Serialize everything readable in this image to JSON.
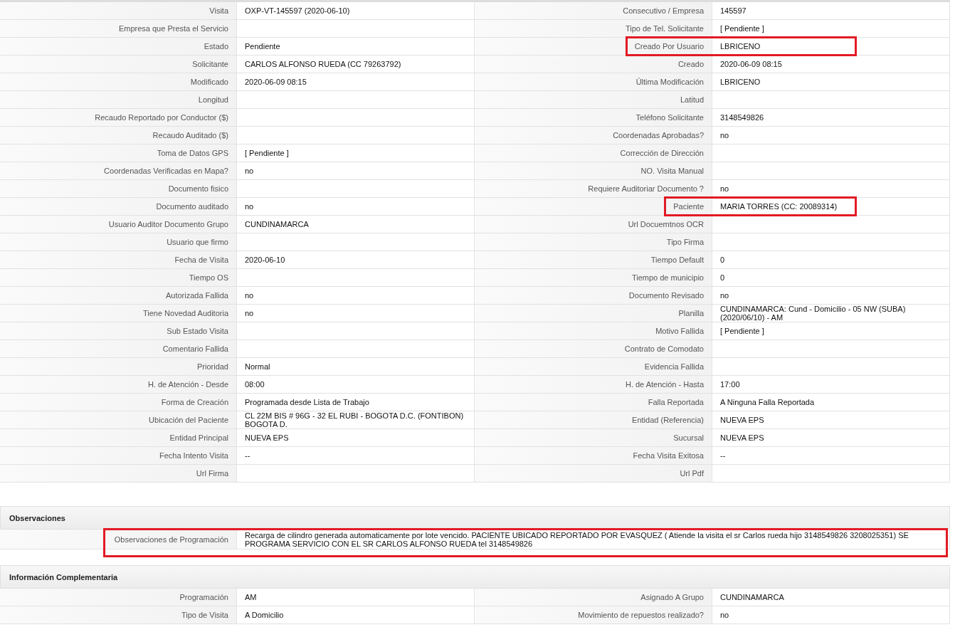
{
  "details": [
    [
      {
        "label": "Visita",
        "value": "OXP-VT-145597 (2020-06-10)",
        "highlighted": false
      },
      {
        "label": "Consecutivo / Empresa",
        "value": "145597",
        "highlighted": false
      }
    ],
    [
      {
        "label": "Empresa que Presta el Servicio",
        "highlighted": false
      },
      {
        "label": "Tipo de Tel. Solicitante",
        "value": "[ Pendiente ]",
        "highlighted": false
      }
    ],
    [
      {
        "label": "Estado",
        "value": "Pendiente",
        "highlighted": false
      },
      {
        "label": "Creado Por Usuario",
        "value": "LBRICENO",
        "highlighted": true
      }
    ],
    [
      {
        "label": "Solicitante",
        "value": "CARLOS ALFONSO RUEDA (CC 79263792)",
        "highlighted": false
      },
      {
        "label": "Creado",
        "value": "2020-06-09 08:15",
        "highlighted": false
      }
    ],
    [
      {
        "label": "Modificado",
        "value": "2020-06-09 08:15",
        "highlighted": false
      },
      {
        "label": "Última Modificación",
        "value": "LBRICENO",
        "highlighted": false
      }
    ],
    [
      {
        "label": "Longitud",
        "highlighted": false
      },
      {
        "label": "Latitud",
        "highlighted": false
      }
    ],
    [
      {
        "label": "Recaudo Reportado por Conductor ($)",
        "highlighted": false
      },
      {
        "label": "Teléfono Solicitante",
        "value": "3148549826",
        "highlighted": false
      }
    ],
    [
      {
        "label": "Recaudo Auditado ($)",
        "highlighted": false
      },
      {
        "label": "Coordenadas Aprobadas?",
        "value": "no",
        "highlighted": false
      }
    ],
    [
      {
        "label": "Toma de Datos GPS",
        "value": "[ Pendiente ]",
        "highlighted": false
      },
      {
        "label": "Corrección de Dirección",
        "highlighted": false
      }
    ],
    [
      {
        "label": "Coordenadas Verificadas en Mapa?",
        "value": "no",
        "highlighted": false
      },
      {
        "label": "NO. Visita Manual",
        "highlighted": false
      }
    ],
    [
      {
        "label": "Documento fisico",
        "highlighted": false
      },
      {
        "label": "Requiere Auditoriar Documento ?",
        "value": "no",
        "highlighted": false
      }
    ],
    [
      {
        "label": "Documento auditado",
        "value": "no",
        "highlighted": false
      },
      {
        "label": "Paciente",
        "value": "MARIA TORRES (CC: 20089314)",
        "highlighted": true
      }
    ],
    [
      {
        "label": "Usuario Auditor Documento Grupo",
        "value": "CUNDINAMARCA",
        "highlighted": false
      },
      {
        "label": "Url Docuemtnos OCR",
        "highlighted": false
      }
    ],
    [
      {
        "label": "Usuario que firmo",
        "highlighted": false
      },
      {
        "label": "Tipo Firma",
        "highlighted": false
      }
    ],
    [
      {
        "label": "Fecha de Visita",
        "value": "2020-06-10",
        "highlighted": false
      },
      {
        "label": "Tiempo Default",
        "value": "0",
        "highlighted": false
      }
    ],
    [
      {
        "label": "Tiempo OS",
        "highlighted": false
      },
      {
        "label": "Tiempo de municipio",
        "value": "0",
        "highlighted": false
      }
    ],
    [
      {
        "label": "Autorizada Fallida",
        "value": "no",
        "highlighted": false
      },
      {
        "label": "Documento Revisado",
        "value": "no",
        "highlighted": false
      }
    ],
    [
      {
        "label": "Tiene Novedad Auditoria",
        "value": "no",
        "highlighted": false
      },
      {
        "label": "Planilla",
        "value": "CUNDINAMARCA: Cund - Domicilio - 05 NW (SUBA) (2020/06/10) - AM",
        "highlighted": false
      }
    ],
    [
      {
        "label": "Sub Estado Visita",
        "highlighted": false
      },
      {
        "label": "Motivo Fallida",
        "value": "[ Pendiente ]",
        "highlighted": false
      }
    ],
    [
      {
        "label": "Comentario Fallida",
        "highlighted": false
      },
      {
        "label": "Contrato de Comodato",
        "highlighted": false
      }
    ],
    [
      {
        "label": "Prioridad",
        "value": "Normal",
        "highlighted": false
      },
      {
        "label": "Evidencia Fallida",
        "highlighted": false
      }
    ],
    [
      {
        "label": "H. de Atención - Desde",
        "value": "08:00",
        "highlighted": false
      },
      {
        "label": "H. de Atención - Hasta",
        "value": "17:00",
        "highlighted": false
      }
    ],
    [
      {
        "label": "Forma de Creación",
        "value": "Programada desde Lista de Trabajo",
        "highlighted": false
      },
      {
        "label": "Falla Reportada",
        "value": "A Ninguna Falla Reportada",
        "highlighted": false
      }
    ],
    [
      {
        "label": "Ubicación del Paciente",
        "value": "CL 22M BIS # 96G - 32 EL RUBI - BOGOTA D.C. (FONTIBON) BOGOTA D.",
        "highlighted": false
      },
      {
        "label": "Entidad (Referencia)",
        "value": "NUEVA EPS",
        "highlighted": false
      }
    ],
    [
      {
        "label": "Entidad Principal",
        "value": "NUEVA EPS",
        "highlighted": false
      },
      {
        "label": "Sucursal",
        "value": "NUEVA EPS",
        "highlighted": false
      }
    ],
    [
      {
        "label": "Fecha Intento Visita",
        "value": "--",
        "highlighted": false
      },
      {
        "label": "Fecha Visita Exitosa",
        "value": "--",
        "highlighted": false
      }
    ],
    [
      {
        "label": "Url Firma",
        "highlighted": false
      },
      {
        "label": "Url Pdf",
        "highlighted": false
      }
    ]
  ],
  "observaciones": {
    "title": "Observaciones",
    "rows": [
      {
        "label": "Observaciones de Programación",
        "value": "Recarga de cilindro generada automaticamente por lote vencido. PACIENTE UBICADO REPORTADO POR EVASQUEZ ( Atiende la visita el sr Carlos rueda hijo 3148549826 3208025351) SE PROGRAMA SERVICIO CON EL SR CARLOS ALFONSO RUEDA tel 3148549826",
        "highlighted": true
      }
    ]
  },
  "complementaria": {
    "title": "Información Complementaria",
    "rows": [
      [
        {
          "label": "Programación",
          "value": "AM",
          "highlighted": false
        },
        {
          "label": "Asignado A Grupo",
          "value": "CUNDINAMARCA",
          "highlighted": false
        }
      ],
      [
        {
          "label": "Tipo de Visita",
          "value": "A Domicilio",
          "highlighted": false
        },
        {
          "label": "Movimiento de repuestos realizado?",
          "value": "no",
          "highlighted": false
        }
      ]
    ]
  }
}
